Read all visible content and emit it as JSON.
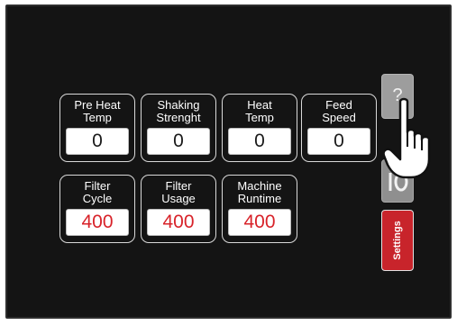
{
  "tiles": [
    {
      "label": "Pre Heat\nTemp",
      "value": "0"
    },
    {
      "label": "Shaking\nStrenght",
      "value": "0"
    },
    {
      "label": "Heat\nTemp",
      "value": "0"
    },
    {
      "label": "Feed\nSpeed",
      "value": "0"
    },
    {
      "label": "Filter\nCycle",
      "value": "400"
    },
    {
      "label": "Filter\nUsage",
      "value": "400"
    },
    {
      "label": "Machine\nRuntime",
      "value": "400"
    }
  ],
  "side_buttons": {
    "help_label": "?",
    "power_icon": "power-icon",
    "settings_label": "Settings"
  },
  "colors": {
    "screen_bg": "#141414",
    "tile_border": "#d9d9d9",
    "counter_value": "#d8232a",
    "settings_button": "#c8242b"
  },
  "pointer_icon": "hand-pointer-icon"
}
